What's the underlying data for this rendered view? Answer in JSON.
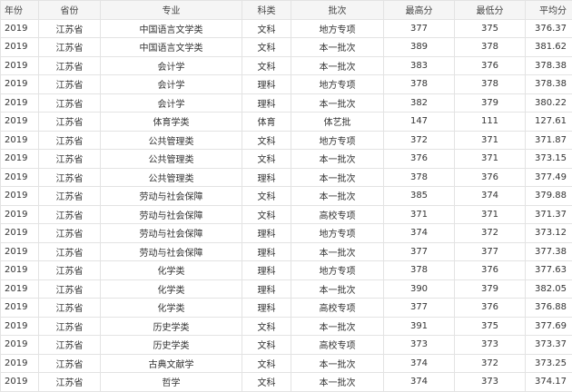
{
  "table": {
    "headers": [
      "年份",
      "省份",
      "专业",
      "科类",
      "批次",
      "最高分",
      "最低分",
      "平均分"
    ],
    "rows": [
      [
        "2019",
        "江苏省",
        "中国语言文学类",
        "文科",
        "地方专项",
        "377",
        "375",
        "376.37"
      ],
      [
        "2019",
        "江苏省",
        "中国语言文学类",
        "文科",
        "本一批次",
        "389",
        "378",
        "381.62"
      ],
      [
        "2019",
        "江苏省",
        "会计学",
        "文科",
        "本一批次",
        "383",
        "376",
        "378.38"
      ],
      [
        "2019",
        "江苏省",
        "会计学",
        "理科",
        "地方专项",
        "378",
        "378",
        "378.38"
      ],
      [
        "2019",
        "江苏省",
        "会计学",
        "理科",
        "本一批次",
        "382",
        "379",
        "380.22"
      ],
      [
        "2019",
        "江苏省",
        "体育学类",
        "体育",
        "体艺批",
        "147",
        "111",
        "127.61"
      ],
      [
        "2019",
        "江苏省",
        "公共管理类",
        "文科",
        "地方专项",
        "372",
        "371",
        "371.87"
      ],
      [
        "2019",
        "江苏省",
        "公共管理类",
        "文科",
        "本一批次",
        "376",
        "371",
        "373.15"
      ],
      [
        "2019",
        "江苏省",
        "公共管理类",
        "理科",
        "本一批次",
        "378",
        "376",
        "377.49"
      ],
      [
        "2019",
        "江苏省",
        "劳动与社会保障",
        "文科",
        "本一批次",
        "385",
        "374",
        "379.88"
      ],
      [
        "2019",
        "江苏省",
        "劳动与社会保障",
        "文科",
        "高校专项",
        "371",
        "371",
        "371.37"
      ],
      [
        "2019",
        "江苏省",
        "劳动与社会保障",
        "理科",
        "地方专项",
        "374",
        "372",
        "373.12"
      ],
      [
        "2019",
        "江苏省",
        "劳动与社会保障",
        "理科",
        "本一批次",
        "377",
        "377",
        "377.38"
      ],
      [
        "2019",
        "江苏省",
        "化学类",
        "理科",
        "地方专项",
        "378",
        "376",
        "377.63"
      ],
      [
        "2019",
        "江苏省",
        "化学类",
        "理科",
        "本一批次",
        "390",
        "379",
        "382.05"
      ],
      [
        "2019",
        "江苏省",
        "化学类",
        "理科",
        "高校专项",
        "377",
        "376",
        "376.88"
      ],
      [
        "2019",
        "江苏省",
        "历史学类",
        "文科",
        "本一批次",
        "391",
        "375",
        "377.69"
      ],
      [
        "2019",
        "江苏省",
        "历史学类",
        "文科",
        "高校专项",
        "373",
        "373",
        "373.37"
      ],
      [
        "2019",
        "江苏省",
        "古典文献学",
        "文科",
        "本一批次",
        "374",
        "372",
        "373.25"
      ],
      [
        "2019",
        "江苏省",
        "哲学",
        "文科",
        "本一批次",
        "374",
        "373",
        "374.17"
      ]
    ]
  }
}
